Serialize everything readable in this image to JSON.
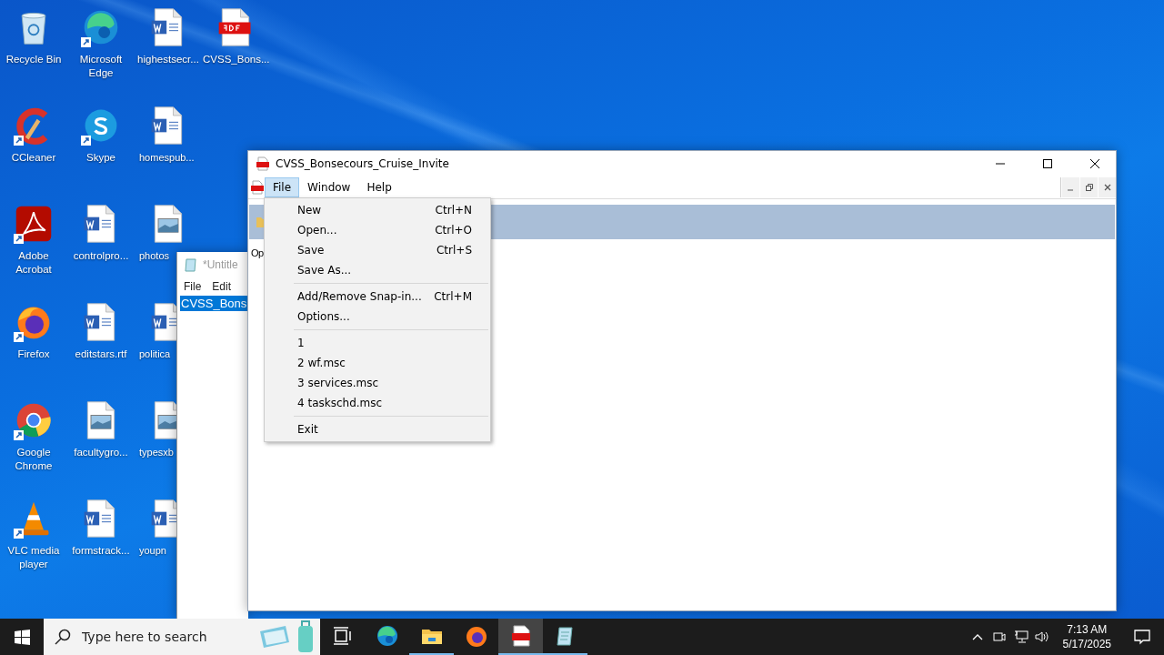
{
  "desktop_icon_rows": [
    [
      {
        "label": "Recycle Bin",
        "kind": "recycle",
        "shortcut": false
      },
      {
        "label": "Microsoft Edge",
        "kind": "edge",
        "shortcut": true
      },
      {
        "label": "highestsecr...",
        "kind": "word",
        "shortcut": false
      },
      {
        "label": "CVSS_Bons...",
        "kind": "pdf",
        "shortcut": false
      }
    ],
    [
      {
        "label": "CCleaner",
        "kind": "ccleaner",
        "shortcut": true
      },
      {
        "label": "Skype",
        "kind": "skype",
        "shortcut": true
      },
      {
        "label": "homespub...",
        "kind": "word",
        "shortcut": false
      }
    ],
    [
      {
        "label": "Adobe Acrobat",
        "kind": "acrobat",
        "shortcut": true
      },
      {
        "label": "controlpro...",
        "kind": "word",
        "shortcut": false
      },
      {
        "label": "photos",
        "kind": "image",
        "shortcut": false
      }
    ],
    [
      {
        "label": "Firefox",
        "kind": "firefox",
        "shortcut": true
      },
      {
        "label": "editstars.rtf",
        "kind": "word",
        "shortcut": false
      },
      {
        "label": "politica",
        "kind": "word",
        "shortcut": false
      }
    ],
    [
      {
        "label": "Google Chrome",
        "kind": "chrome",
        "shortcut": true
      },
      {
        "label": "facultygro...",
        "kind": "image",
        "shortcut": false
      },
      {
        "label": "typesxb",
        "kind": "image",
        "shortcut": false
      }
    ],
    [
      {
        "label": "VLC media player",
        "kind": "vlc",
        "shortcut": true
      },
      {
        "label": "formstrack...",
        "kind": "word",
        "shortcut": false
      },
      {
        "label": "youpn",
        "kind": "word",
        "shortcut": false
      }
    ]
  ],
  "notepad": {
    "title": "*Untitle",
    "menu": [
      "File",
      "Edit"
    ],
    "selected_text": "CVSS_Bons"
  },
  "window": {
    "title": "CVSS_Bonsecours_Cruise_Invite",
    "menu": [
      {
        "label": "File",
        "selected": true
      },
      {
        "label": "Window",
        "selected": false
      },
      {
        "label": "Help",
        "selected": false
      }
    ],
    "content_text": "Op"
  },
  "file_menu": {
    "groups": [
      [
        {
          "label": "New",
          "shortcut": "Ctrl+N"
        },
        {
          "label": "Open...",
          "shortcut": "Ctrl+O"
        },
        {
          "label": "Save",
          "shortcut": "Ctrl+S"
        },
        {
          "label": "Save As..."
        }
      ],
      [
        {
          "label": "Add/Remove Snap-in...",
          "shortcut": "Ctrl+M"
        },
        {
          "label": "Options..."
        }
      ],
      [
        {
          "label": "1"
        },
        {
          "label": "2 wf.msc"
        },
        {
          "label": "3 services.msc"
        },
        {
          "label": "4 taskschd.msc"
        }
      ],
      [
        {
          "label": "Exit"
        }
      ]
    ]
  },
  "taskbar": {
    "search": {
      "placeholder": "Type here to search"
    },
    "apps": [
      {
        "kind": "taskview",
        "running": false,
        "selected": false
      },
      {
        "kind": "edge",
        "running": false,
        "selected": false
      },
      {
        "kind": "explorer",
        "running": true,
        "selected": false
      },
      {
        "kind": "firefox",
        "running": false,
        "selected": false
      },
      {
        "kind": "pdf",
        "running": true,
        "selected": true
      },
      {
        "kind": "notepad",
        "running": true,
        "selected": false
      }
    ],
    "time": "7:13 AM",
    "date": "5/17/2025"
  }
}
